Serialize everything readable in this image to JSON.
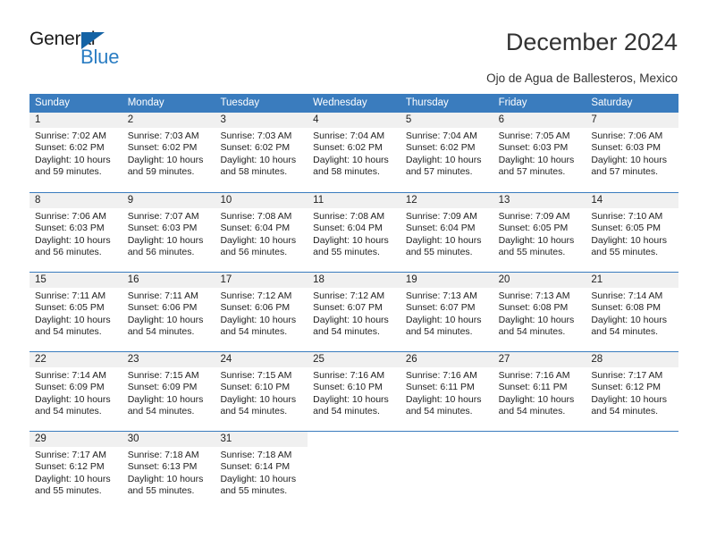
{
  "brand": {
    "name_part1": "General",
    "name_part2": "Blue",
    "triangle_color": "#1463a5",
    "blue_color": "#2a7dc3"
  },
  "header": {
    "title": "December 2024",
    "subtitle": "Ojo de Agua de Ballesteros, Mexico"
  },
  "theme": {
    "header_blue": "#3a7cbe",
    "day_band_gray": "#f0f0f0",
    "text_color": "#222222"
  },
  "weekdays": [
    "Sunday",
    "Monday",
    "Tuesday",
    "Wednesday",
    "Thursday",
    "Friday",
    "Saturday"
  ],
  "weeks": [
    [
      {
        "day": "1",
        "sunrise": "Sunrise: 7:02 AM",
        "sunset": "Sunset: 6:02 PM",
        "daylight1": "Daylight: 10 hours",
        "daylight2": "and 59 minutes."
      },
      {
        "day": "2",
        "sunrise": "Sunrise: 7:03 AM",
        "sunset": "Sunset: 6:02 PM",
        "daylight1": "Daylight: 10 hours",
        "daylight2": "and 59 minutes."
      },
      {
        "day": "3",
        "sunrise": "Sunrise: 7:03 AM",
        "sunset": "Sunset: 6:02 PM",
        "daylight1": "Daylight: 10 hours",
        "daylight2": "and 58 minutes."
      },
      {
        "day": "4",
        "sunrise": "Sunrise: 7:04 AM",
        "sunset": "Sunset: 6:02 PM",
        "daylight1": "Daylight: 10 hours",
        "daylight2": "and 58 minutes."
      },
      {
        "day": "5",
        "sunrise": "Sunrise: 7:04 AM",
        "sunset": "Sunset: 6:02 PM",
        "daylight1": "Daylight: 10 hours",
        "daylight2": "and 57 minutes."
      },
      {
        "day": "6",
        "sunrise": "Sunrise: 7:05 AM",
        "sunset": "Sunset: 6:03 PM",
        "daylight1": "Daylight: 10 hours",
        "daylight2": "and 57 minutes."
      },
      {
        "day": "7",
        "sunrise": "Sunrise: 7:06 AM",
        "sunset": "Sunset: 6:03 PM",
        "daylight1": "Daylight: 10 hours",
        "daylight2": "and 57 minutes."
      }
    ],
    [
      {
        "day": "8",
        "sunrise": "Sunrise: 7:06 AM",
        "sunset": "Sunset: 6:03 PM",
        "daylight1": "Daylight: 10 hours",
        "daylight2": "and 56 minutes."
      },
      {
        "day": "9",
        "sunrise": "Sunrise: 7:07 AM",
        "sunset": "Sunset: 6:03 PM",
        "daylight1": "Daylight: 10 hours",
        "daylight2": "and 56 minutes."
      },
      {
        "day": "10",
        "sunrise": "Sunrise: 7:08 AM",
        "sunset": "Sunset: 6:04 PM",
        "daylight1": "Daylight: 10 hours",
        "daylight2": "and 56 minutes."
      },
      {
        "day": "11",
        "sunrise": "Sunrise: 7:08 AM",
        "sunset": "Sunset: 6:04 PM",
        "daylight1": "Daylight: 10 hours",
        "daylight2": "and 55 minutes."
      },
      {
        "day": "12",
        "sunrise": "Sunrise: 7:09 AM",
        "sunset": "Sunset: 6:04 PM",
        "daylight1": "Daylight: 10 hours",
        "daylight2": "and 55 minutes."
      },
      {
        "day": "13",
        "sunrise": "Sunrise: 7:09 AM",
        "sunset": "Sunset: 6:05 PM",
        "daylight1": "Daylight: 10 hours",
        "daylight2": "and 55 minutes."
      },
      {
        "day": "14",
        "sunrise": "Sunrise: 7:10 AM",
        "sunset": "Sunset: 6:05 PM",
        "daylight1": "Daylight: 10 hours",
        "daylight2": "and 55 minutes."
      }
    ],
    [
      {
        "day": "15",
        "sunrise": "Sunrise: 7:11 AM",
        "sunset": "Sunset: 6:05 PM",
        "daylight1": "Daylight: 10 hours",
        "daylight2": "and 54 minutes."
      },
      {
        "day": "16",
        "sunrise": "Sunrise: 7:11 AM",
        "sunset": "Sunset: 6:06 PM",
        "daylight1": "Daylight: 10 hours",
        "daylight2": "and 54 minutes."
      },
      {
        "day": "17",
        "sunrise": "Sunrise: 7:12 AM",
        "sunset": "Sunset: 6:06 PM",
        "daylight1": "Daylight: 10 hours",
        "daylight2": "and 54 minutes."
      },
      {
        "day": "18",
        "sunrise": "Sunrise: 7:12 AM",
        "sunset": "Sunset: 6:07 PM",
        "daylight1": "Daylight: 10 hours",
        "daylight2": "and 54 minutes."
      },
      {
        "day": "19",
        "sunrise": "Sunrise: 7:13 AM",
        "sunset": "Sunset: 6:07 PM",
        "daylight1": "Daylight: 10 hours",
        "daylight2": "and 54 minutes."
      },
      {
        "day": "20",
        "sunrise": "Sunrise: 7:13 AM",
        "sunset": "Sunset: 6:08 PM",
        "daylight1": "Daylight: 10 hours",
        "daylight2": "and 54 minutes."
      },
      {
        "day": "21",
        "sunrise": "Sunrise: 7:14 AM",
        "sunset": "Sunset: 6:08 PM",
        "daylight1": "Daylight: 10 hours",
        "daylight2": "and 54 minutes."
      }
    ],
    [
      {
        "day": "22",
        "sunrise": "Sunrise: 7:14 AM",
        "sunset": "Sunset: 6:09 PM",
        "daylight1": "Daylight: 10 hours",
        "daylight2": "and 54 minutes."
      },
      {
        "day": "23",
        "sunrise": "Sunrise: 7:15 AM",
        "sunset": "Sunset: 6:09 PM",
        "daylight1": "Daylight: 10 hours",
        "daylight2": "and 54 minutes."
      },
      {
        "day": "24",
        "sunrise": "Sunrise: 7:15 AM",
        "sunset": "Sunset: 6:10 PM",
        "daylight1": "Daylight: 10 hours",
        "daylight2": "and 54 minutes."
      },
      {
        "day": "25",
        "sunrise": "Sunrise: 7:16 AM",
        "sunset": "Sunset: 6:10 PM",
        "daylight1": "Daylight: 10 hours",
        "daylight2": "and 54 minutes."
      },
      {
        "day": "26",
        "sunrise": "Sunrise: 7:16 AM",
        "sunset": "Sunset: 6:11 PM",
        "daylight1": "Daylight: 10 hours",
        "daylight2": "and 54 minutes."
      },
      {
        "day": "27",
        "sunrise": "Sunrise: 7:16 AM",
        "sunset": "Sunset: 6:11 PM",
        "daylight1": "Daylight: 10 hours",
        "daylight2": "and 54 minutes."
      },
      {
        "day": "28",
        "sunrise": "Sunrise: 7:17 AM",
        "sunset": "Sunset: 6:12 PM",
        "daylight1": "Daylight: 10 hours",
        "daylight2": "and 54 minutes."
      }
    ],
    [
      {
        "day": "29",
        "sunrise": "Sunrise: 7:17 AM",
        "sunset": "Sunset: 6:12 PM",
        "daylight1": "Daylight: 10 hours",
        "daylight2": "and 55 minutes."
      },
      {
        "day": "30",
        "sunrise": "Sunrise: 7:18 AM",
        "sunset": "Sunset: 6:13 PM",
        "daylight1": "Daylight: 10 hours",
        "daylight2": "and 55 minutes."
      },
      {
        "day": "31",
        "sunrise": "Sunrise: 7:18 AM",
        "sunset": "Sunset: 6:14 PM",
        "daylight1": "Daylight: 10 hours",
        "daylight2": "and 55 minutes."
      },
      {
        "day": "",
        "sunrise": "",
        "sunset": "",
        "daylight1": "",
        "daylight2": ""
      },
      {
        "day": "",
        "sunrise": "",
        "sunset": "",
        "daylight1": "",
        "daylight2": ""
      },
      {
        "day": "",
        "sunrise": "",
        "sunset": "",
        "daylight1": "",
        "daylight2": ""
      },
      {
        "day": "",
        "sunrise": "",
        "sunset": "",
        "daylight1": "",
        "daylight2": ""
      }
    ]
  ]
}
